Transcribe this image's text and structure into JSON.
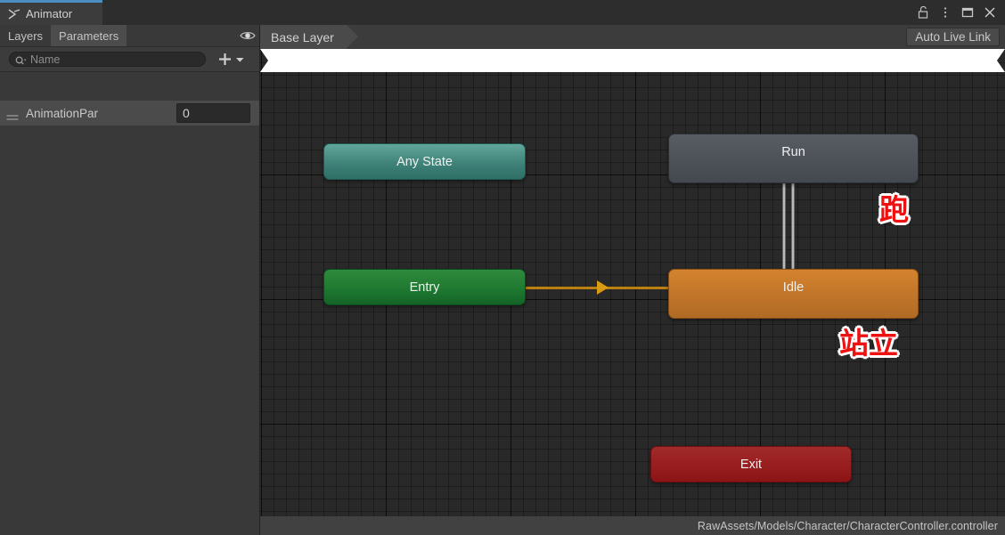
{
  "window": {
    "tab_label": "Animator",
    "tab_icon": "animator-icon",
    "controls": [
      {
        "name": "lock-icon",
        "label": "Lock"
      },
      {
        "name": "kebab-menu-icon",
        "label": "More"
      },
      {
        "name": "maximize-icon",
        "label": "Maximize"
      },
      {
        "name": "close-icon",
        "label": "Close"
      }
    ]
  },
  "left_panel": {
    "tabs": [
      {
        "label": "Layers",
        "active": false
      },
      {
        "label": "Parameters",
        "active": true
      }
    ],
    "eye_icon": "eye-icon",
    "search": {
      "placeholder": "Name",
      "value": "",
      "icon": "search-icon"
    },
    "add_button": {
      "label": "+",
      "icon": "plus-icon"
    },
    "add_dropdown": {
      "icon": "chevron-down-icon"
    },
    "parameters": [
      {
        "name": "AnimationPar",
        "value": "0",
        "handle_icon": "drag-handle-icon"
      }
    ]
  },
  "graph": {
    "breadcrumb": "Base Layer",
    "auto_live_link": "Auto Live Link",
    "status_path": "RawAssets/Models/Character/CharacterController.controller",
    "nodes": [
      {
        "id": "any-state",
        "label": "Any State",
        "color": "#3f8278"
      },
      {
        "id": "entry",
        "label": "Entry",
        "color": "#1f7a31"
      },
      {
        "id": "run",
        "label": "Run",
        "color": "#4c5057"
      },
      {
        "id": "idle",
        "label": "Idle",
        "color": "#c2762a"
      },
      {
        "id": "exit",
        "label": "Exit",
        "color": "#9a1f20"
      }
    ],
    "annotations": [
      {
        "id": "run-annotation",
        "text": "跑",
        "color": "#ee1111"
      },
      {
        "id": "idle-annotation",
        "text": "站立",
        "color": "#ee1111"
      }
    ],
    "transitions": [
      {
        "from": "entry",
        "to": "idle",
        "color": "#d79b16"
      },
      {
        "from": "run",
        "to": "idle",
        "color": "#ffffff"
      },
      {
        "from": "idle",
        "to": "run",
        "color": "#ffffff"
      }
    ]
  }
}
